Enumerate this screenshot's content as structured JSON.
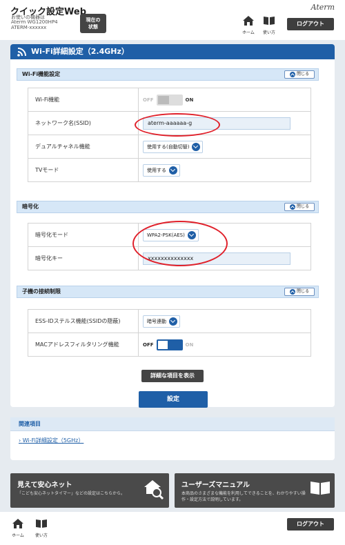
{
  "header": {
    "app_title": "クイック設定Web",
    "device_label": "お使いの機器は",
    "model": "Aterm WG1200HP4",
    "device_id": "ATERM-xxxxxx",
    "status_button": [
      "現在の",
      "状態"
    ],
    "brand": "Aterm",
    "home_label": "ホーム",
    "help_label": "使い方",
    "logout_label": "ログアウト"
  },
  "page_title": "Wi-Fi詳細設定（2.4GHz）",
  "sections": {
    "wifi": {
      "title": "Wi-Fi機能設定",
      "close_label": "閉じる",
      "rows": {
        "wifi_function": {
          "label": "Wi-Fi機能",
          "off": "OFF",
          "on": "ON"
        },
        "ssid": {
          "label": "ネットワーク名(SSID)",
          "value": "aterm-aaaaaa-g"
        },
        "dual_channel": {
          "label": "デュアルチャネル機能",
          "value": "使用する(自動切替)"
        },
        "tv_mode": {
          "label": "TVモード",
          "value": "使用する"
        }
      }
    },
    "encryption": {
      "title": "暗号化",
      "close_label": "閉じる",
      "rows": {
        "mode": {
          "label": "暗号化モード",
          "value": "WPA2-PSK(AES)"
        },
        "key": {
          "label": "暗号化キー",
          "value": "xxxxxxxxxxxxxx"
        }
      }
    },
    "client_limit": {
      "title": "子機の接続制限",
      "close_label": "閉じる",
      "rows": {
        "stealth": {
          "label": "ESS-IDステルス機能(SSIDの隠蔽)",
          "value": "暗号連動"
        },
        "mac_filter": {
          "label": "MACアドレスフィルタリング機能",
          "off": "OFF",
          "on": "ON"
        }
      }
    }
  },
  "buttons": {
    "advanced": "詳細な項目を表示",
    "apply": "設定"
  },
  "related": {
    "title": "関連項目",
    "link": "Wi-Fi詳細設定（5GHz）"
  },
  "banners": {
    "left": {
      "title": "見えて安心ネット",
      "desc": "「こども安心ネットタイマー」などの設定はこちらから。"
    },
    "right": {
      "title": "ユーザーズマニュアル",
      "desc1": "本商品のさまざまな機能を利用してできることを、わかりやすい操",
      "desc2": "作・設定方法で説明しています。"
    }
  },
  "footer": {
    "home_label": "ホーム",
    "help_label": "使い方",
    "logout_label": "ログアウト"
  },
  "colors": {
    "primary": "#1f5fa7",
    "dark": "#444444",
    "highlight": "#e0202a"
  }
}
